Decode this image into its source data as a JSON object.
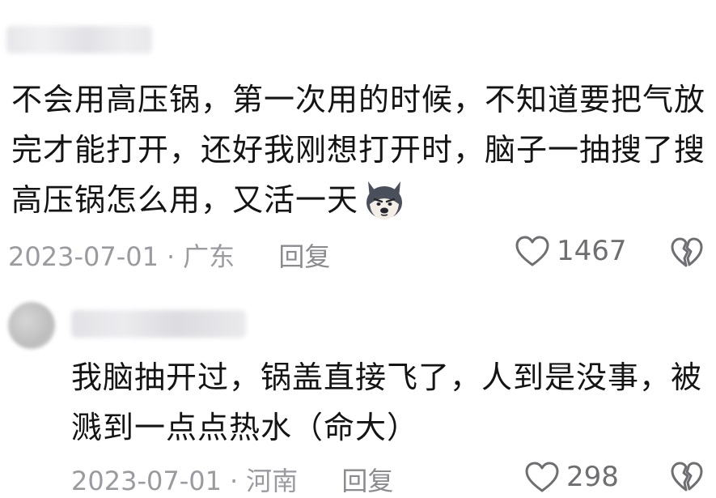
{
  "comments": [
    {
      "text": "不会用高压锅，第一次用的时候，不知道要把气放完才能打开，还好我刚想打开时，脑子一抽搜了搜高压锅怎么用，又活一天",
      "emoji": "husky-dog-emoji",
      "date": "2023-07-01",
      "separator": "·",
      "location": "广东",
      "reply_label": "回复",
      "likes": "1467"
    },
    {
      "text": "我脑抽开过，锅盖直接飞了，人到是没事，被溅到一点点热水（命大）",
      "date": "2023-07-01",
      "separator": "·",
      "location": "河南",
      "reply_label": "回复",
      "likes": "298"
    }
  ],
  "icons": {
    "like": "heart-outline-icon",
    "dislike": "broken-heart-icon"
  },
  "colors": {
    "text": "#141414",
    "meta": "#9a9aa0",
    "icon": "#6e6e73"
  }
}
